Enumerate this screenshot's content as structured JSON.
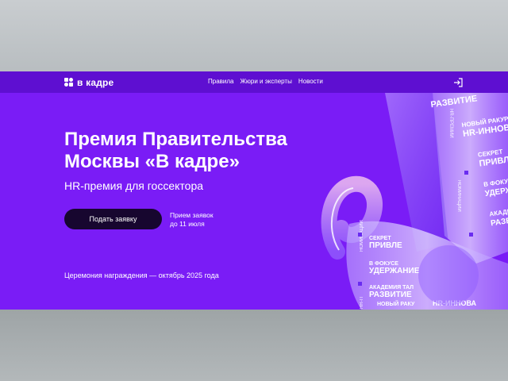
{
  "brand": {
    "logo_text": "в кадре"
  },
  "nav": {
    "links": [
      "Правила",
      "Жюри и эксперты",
      "Новости"
    ]
  },
  "hero": {
    "title_line1": "Премия Правительства",
    "title_line2": "Москвы «В кадре»",
    "subtitle": "HR-премия для госсектора",
    "cta_label": "Подать заявку",
    "deadline_line1": "Прием заявок",
    "deadline_line2": "до 11 июля",
    "ceremony": "Церемония награждения — октябрь 2025 года"
  },
  "ribbon_text": {
    "upper": [
      "РАЗВИТИЕ",
      "HR-ПРЕМИИ",
      "НОВЫЙ РАКУРС",
      "HR-ИННОВ",
      "СЕКРЕТ",
      "ПРИВЛ",
      "НОМИНАЦИИ",
      "В ФОКУС",
      "УДЕРЖА",
      "АКАДЕ",
      "РАЗВИ"
    ],
    "lower": [
      "СЕКРЕТ",
      "ПРИВЛЕ",
      "НОМИНАЦИИ",
      "В ФОКУСЕ",
      "УДЕРЖАНИЕ",
      "АКАДЕМИЯ ТАЛ",
      "РАЗВИТИЕ",
      "НОВЫЙ РАКУ",
      "HR-ИННОВА",
      "HR-П"
    ]
  },
  "colors": {
    "hero_bg": "#7a1cf6",
    "nav_bg": "#5e0fd1",
    "button_bg": "#17062f"
  }
}
